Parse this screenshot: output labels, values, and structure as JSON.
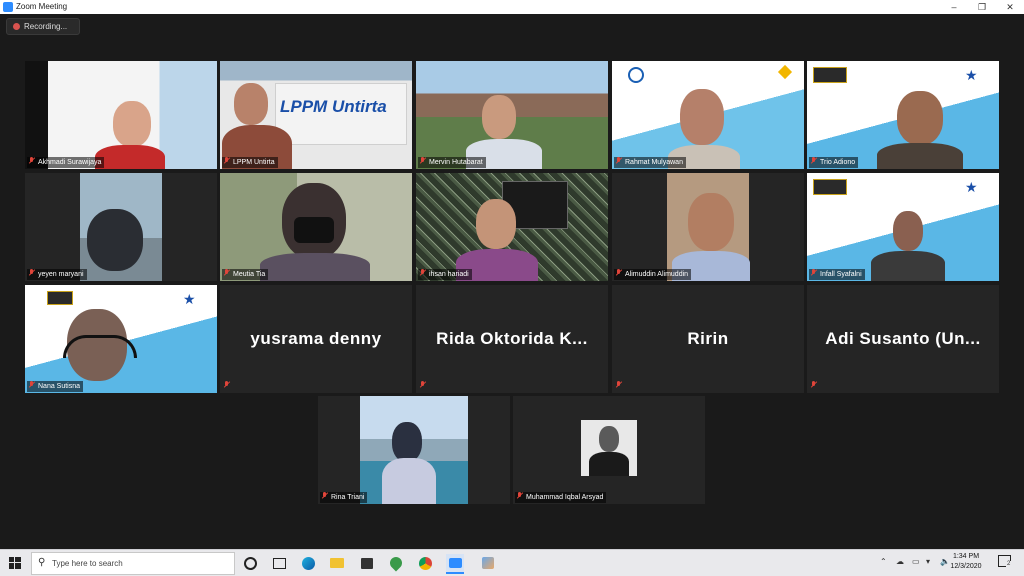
{
  "window": {
    "title": "Zoom Meeting"
  },
  "recording": {
    "label": "Recording..."
  },
  "participants": [
    {
      "name": "Akhmadi Surawijaya"
    },
    {
      "name": "LPPM Untirta"
    },
    {
      "name": "Mervin Hutabarat"
    },
    {
      "name": "Rahmat Mulyawan"
    },
    {
      "name": "Trio Adiono"
    },
    {
      "name": "yeyen maryani"
    },
    {
      "name": "Meutia Tia"
    },
    {
      "name": "ihsan hariadi"
    },
    {
      "name": "Alimuddin Alimuddin"
    },
    {
      "name": "Infall Syafalni"
    },
    {
      "name": "Nana Sutisna"
    },
    {
      "name": "yusrama denny"
    },
    {
      "name": "Rida Oktorida K..."
    },
    {
      "name": "Ririn"
    },
    {
      "name": "Adi Susanto (Un..."
    },
    {
      "name": "Rina Triani"
    },
    {
      "name": "Muhammad Iqbal Arsyad"
    }
  ],
  "lppm_logo": {
    "text": "LPPM Untirta"
  },
  "taskbar": {
    "search_placeholder": "Type here to search",
    "time": "1:34 PM",
    "date": "12/3/2020",
    "notification_count": "2"
  },
  "colors": {
    "active_speaker": "#c9e62f",
    "zoom_blue": "#2d8cff",
    "muted_red": "#e0453a"
  }
}
